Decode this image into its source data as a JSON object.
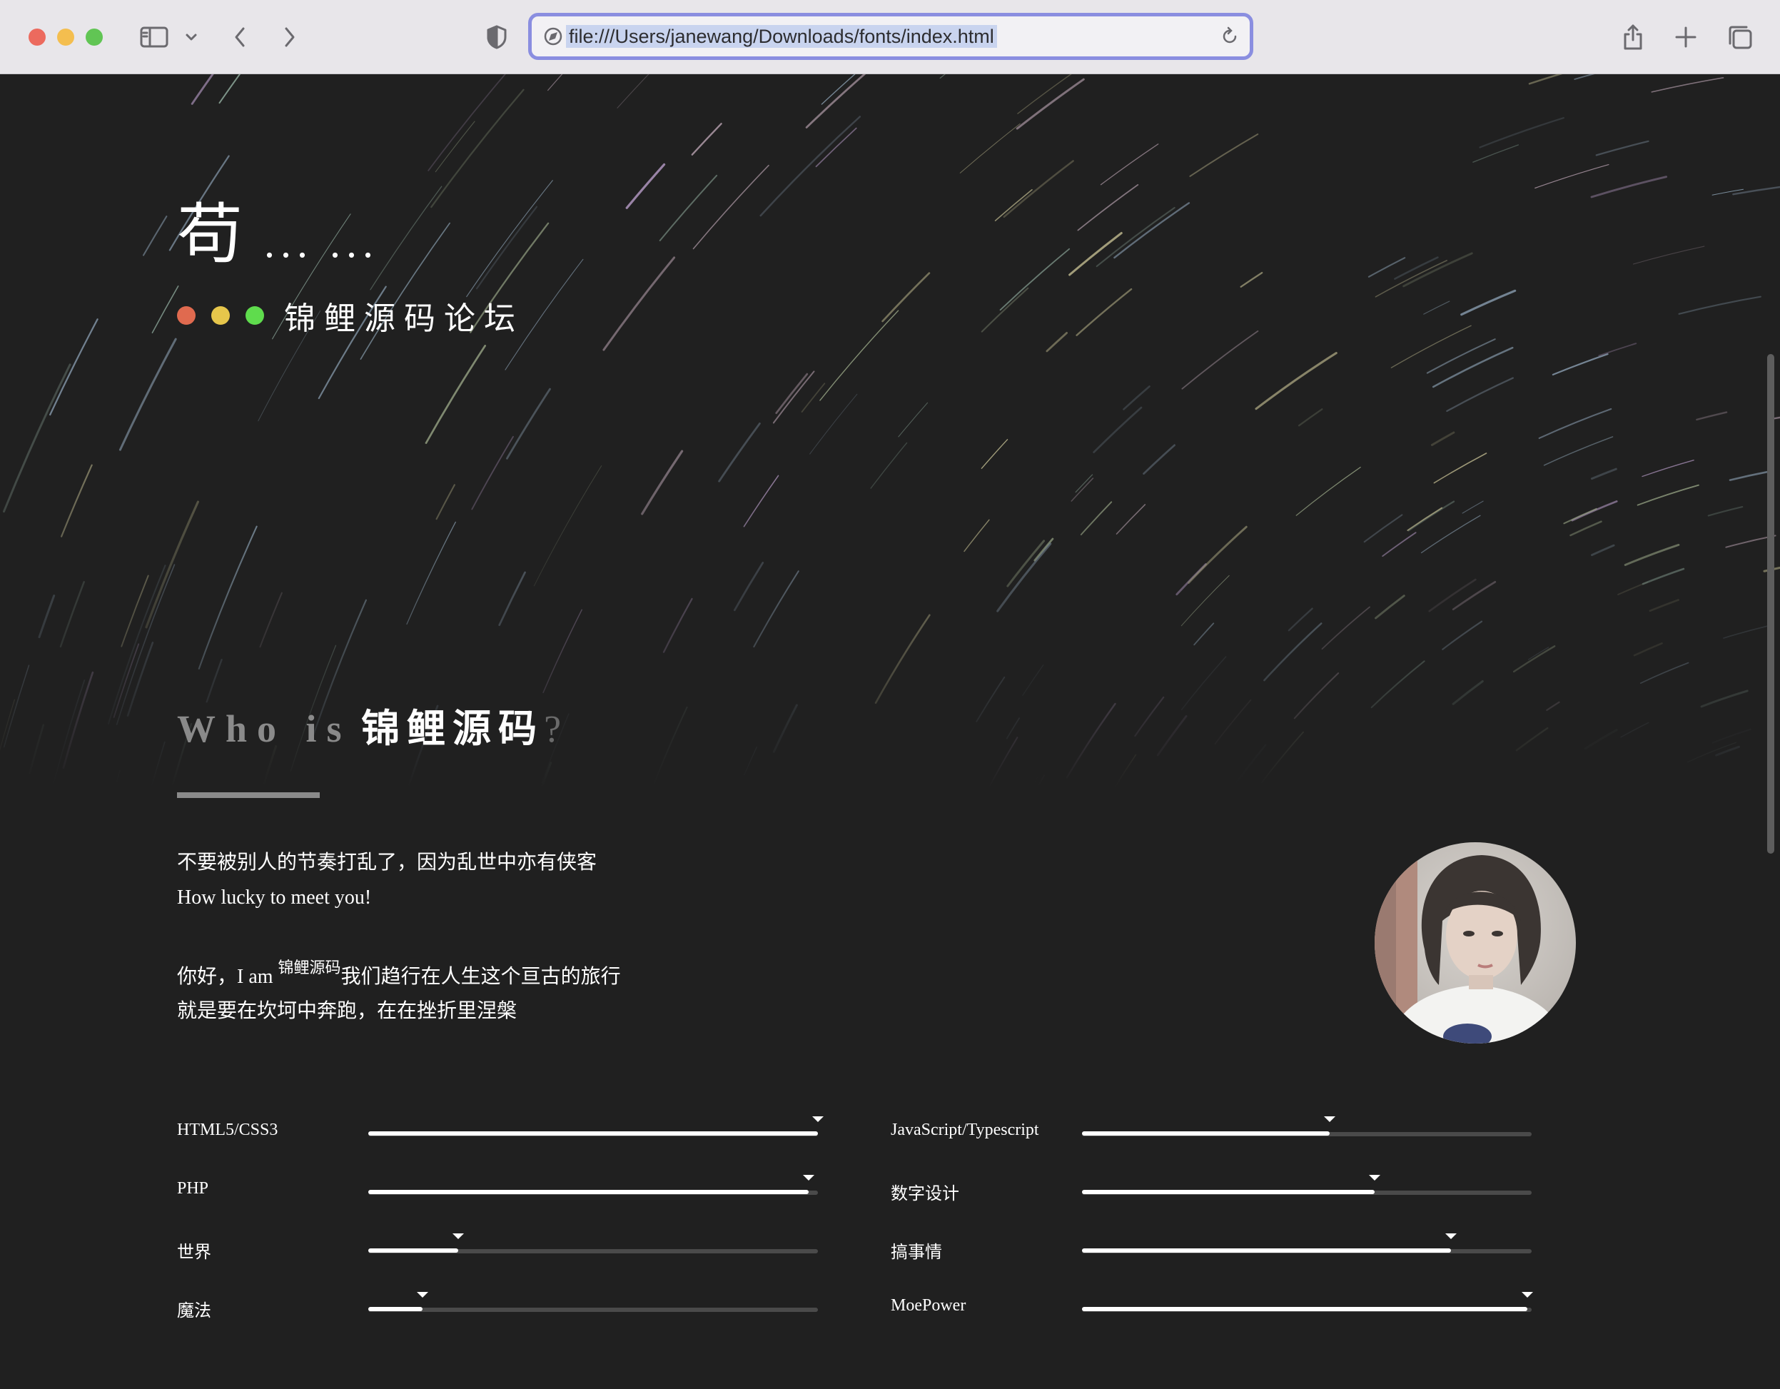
{
  "browser": {
    "url": "file:///Users/janewang/Downloads/fonts/index.html"
  },
  "hero": {
    "logo_char": "苟",
    "logo_dots": "... ...",
    "subtitle": "锦鲤源码论坛",
    "dot_colors": [
      "#e06a4f",
      "#e6c64b",
      "#5fdc4d"
    ]
  },
  "about": {
    "who_prefix": "Who is",
    "who_name": "锦鲤源码",
    "who_suffix": "?",
    "line1": "不要被别人的节奏打乱了，因为乱世中亦有侠客",
    "line2": "How lucky to meet you!",
    "line3_pre": "你好，I am",
    "line3_sup": "锦鲤源码",
    "line3_post": "我们趋行在人生这个亘古的旅行",
    "line4": "就是要在坎坷中奔跑，在在挫折里涅槃"
  },
  "skills": [
    {
      "label": "HTML5/CSS3",
      "value": 100
    },
    {
      "label": "JavaScript/Typescript",
      "value": 55
    },
    {
      "label": "PHP",
      "value": 98
    },
    {
      "label": "数字设计",
      "value": 65
    },
    {
      "label": "世界",
      "value": 20
    },
    {
      "label": "搞事情",
      "value": 82
    },
    {
      "label": "魔法",
      "value": 12
    },
    {
      "label": "MoePower",
      "value": 99
    }
  ]
}
